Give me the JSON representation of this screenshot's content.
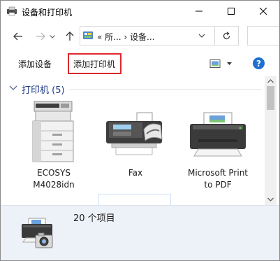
{
  "window": {
    "title": "设备和打印机"
  },
  "address_bar": {
    "path_text": "« 所... › 设备...",
    "icon": "control-panel-icon"
  },
  "toolbar": {
    "add_device_label": "添加设备",
    "add_printer_label": "添加打印机",
    "help_label": "?"
  },
  "group": {
    "title": "打印机 (5)"
  },
  "devices": [
    {
      "label_line1": "ECOSYS",
      "label_line2": "M4028idn",
      "icon": "multifunction-printer-icon"
    },
    {
      "label_line1": "Fax",
      "label_line2": "",
      "icon": "fax-icon"
    },
    {
      "label_line1": "Microsoft Print",
      "label_line2": "to PDF",
      "icon": "printer-icon"
    }
  ],
  "details": {
    "summary": "20 个项目",
    "icon": "printer-camera-icon"
  },
  "colors": {
    "highlight_border": "#e0282c",
    "group_title": "#1e3a8a",
    "details_bg": "#edf1f8",
    "help_blue": "#1e6fd1"
  }
}
